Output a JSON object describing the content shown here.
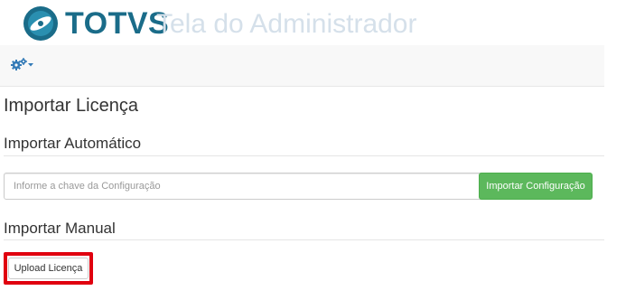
{
  "header": {
    "brand": "TOTVS",
    "app_title": "Tela do Administrador",
    "logo_icon": "totvs-logo-icon"
  },
  "toolbar": {
    "settings_icon": "gears-icon",
    "dropdown_icon": "caret-down-icon"
  },
  "main": {
    "page_title": "Importar Licença",
    "auto_section": {
      "title": "Importar Automático",
      "input_placeholder": "Informe a chave da Configuração",
      "input_value": "",
      "button_label": "Importar Configuração"
    },
    "manual_section": {
      "title": "Importar Manual",
      "upload_label": "Upload Licença"
    }
  },
  "colors": {
    "brand": "#1a6c89",
    "app_title": "#d5e0ea",
    "success": "#5cb85c",
    "highlight": "#e0000f",
    "icon_blue": "#337ab7"
  }
}
